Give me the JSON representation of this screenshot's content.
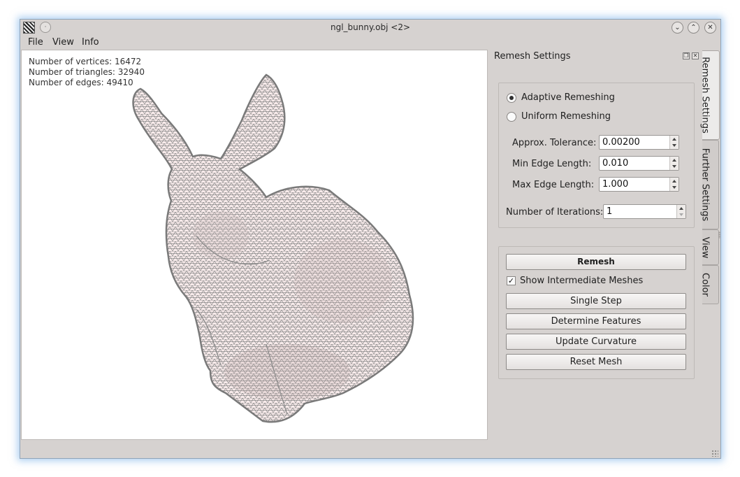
{
  "window": {
    "title": "ngl_bunny.obj <2>",
    "pin_glyph": "·",
    "minimize_glyph": "⌄",
    "maximize_glyph": "⌃",
    "close_glyph": "✕"
  },
  "menu": {
    "items": [
      {
        "label": "File"
      },
      {
        "label": "View"
      },
      {
        "label": "Info"
      }
    ]
  },
  "viewport": {
    "stats": [
      "Number of vertices: 16472",
      "Number of triangles: 32940",
      "Number of edges: 49410"
    ],
    "mesh_color": "#7a7a7a",
    "mesh_fill": "#f4e4e4"
  },
  "panel": {
    "header": "Remesh Settings",
    "float_glyph": "❐",
    "close_glyph": "✕",
    "mode_options": [
      {
        "label": "Adaptive Remeshing",
        "selected": true
      },
      {
        "label": "Uniform Remeshing",
        "selected": false
      }
    ],
    "fields": [
      {
        "label": "Approx. Tolerance:",
        "value": "0.00200"
      },
      {
        "label": "Min Edge Length:",
        "value": "0.010"
      },
      {
        "label": "Max Edge Length:",
        "value": "1.000"
      }
    ],
    "iterations": {
      "label": "Number of Iterations:",
      "value": "1"
    },
    "remesh_button": "Remesh",
    "show_intermediate": {
      "label": "Show Intermediate Meshes",
      "checked": true,
      "check_glyph": "✓"
    },
    "buttons": [
      "Single Step",
      "Determine Features",
      "Update Curvature",
      "Reset Mesh"
    ]
  },
  "tabs": [
    {
      "label": "Remesh Settings",
      "active": true
    },
    {
      "label": "Further Settings",
      "active": false
    },
    {
      "label": "View",
      "active": false
    },
    {
      "label": "Color",
      "active": false
    }
  ]
}
